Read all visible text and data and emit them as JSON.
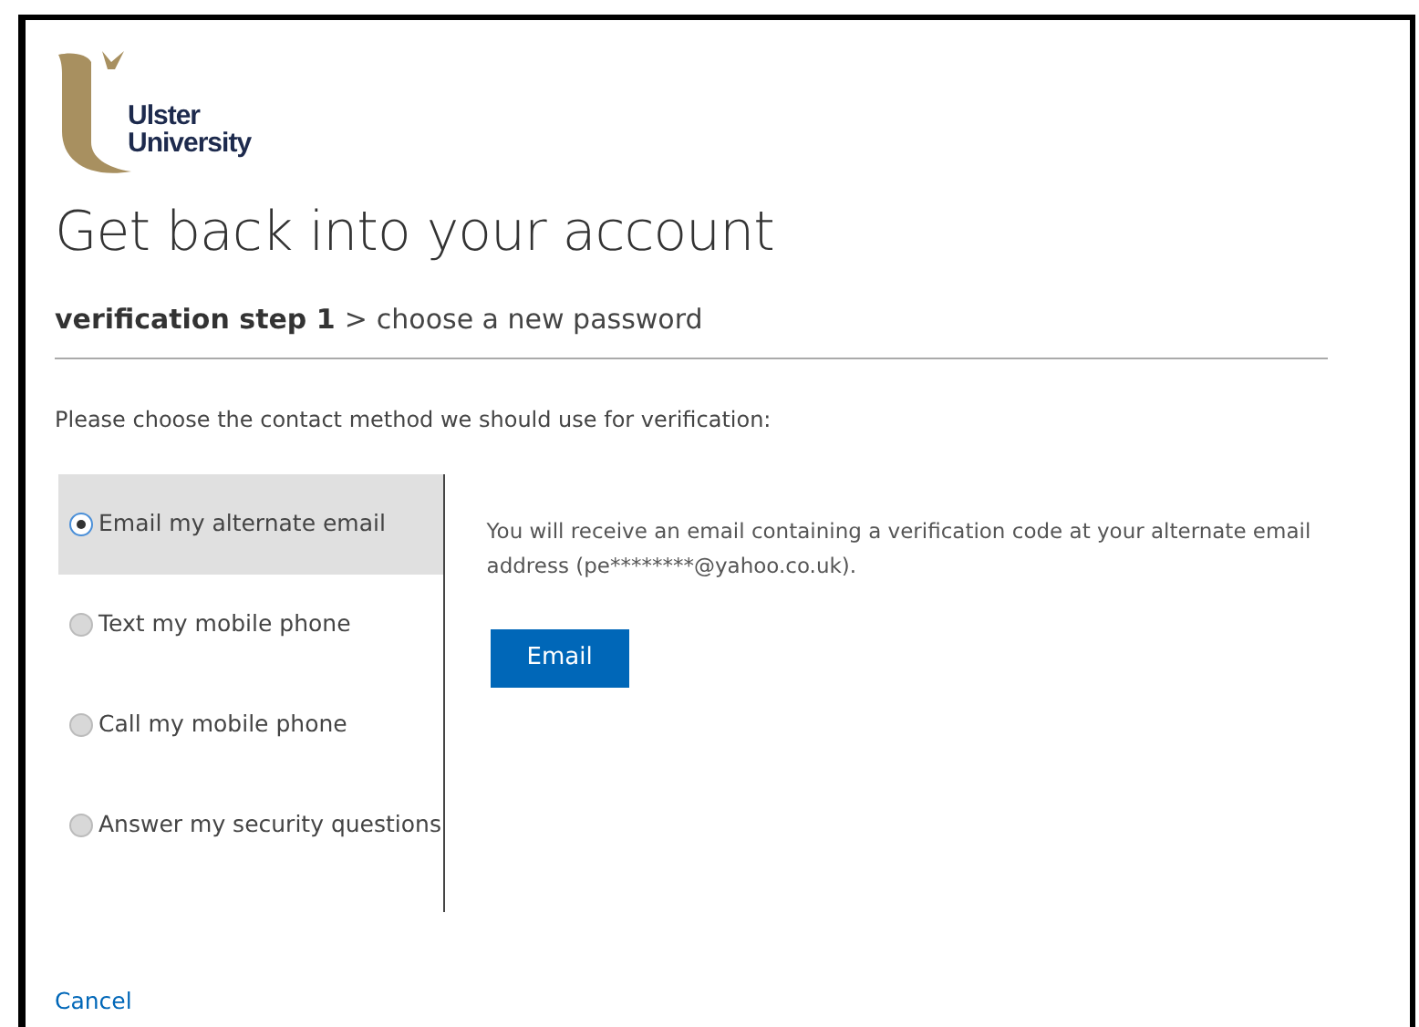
{
  "logo": {
    "line_1": "Ulster",
    "line_2": "University"
  },
  "title": "Get back into your account",
  "breadcrumb": {
    "current": "verification step 1",
    "separator": ">",
    "next": "choose a new password"
  },
  "instruction": "Please choose the contact method we should use for verification:",
  "methods": [
    {
      "label": "Email my alternate email",
      "selected": true
    },
    {
      "label": "Text my mobile phone",
      "selected": false
    },
    {
      "label": "Call my mobile phone",
      "selected": false
    },
    {
      "label": "Answer my security questions",
      "selected": false
    }
  ],
  "detail": {
    "message": "You will receive an email containing a verification code at your alternate email address (pe********@yahoo.co.uk).",
    "button": "Email"
  },
  "cancel": "Cancel"
}
